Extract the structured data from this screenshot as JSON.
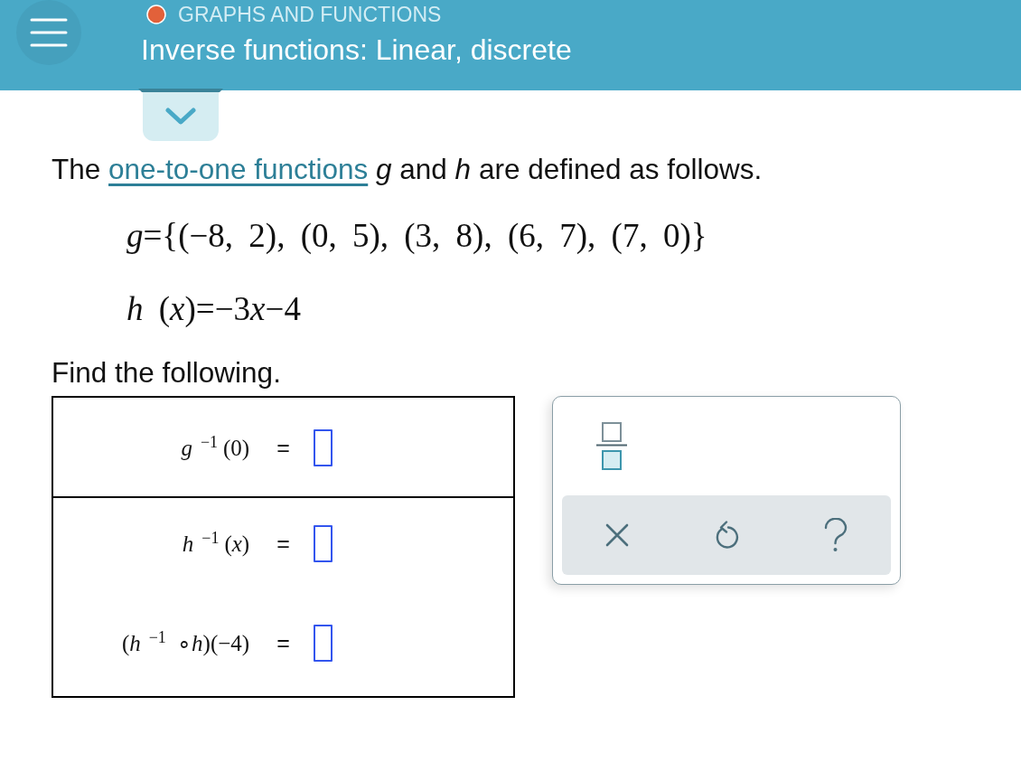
{
  "header": {
    "topic": "GRAPHS AND FUNCTIONS",
    "title": "Inverse functions: Linear, discrete"
  },
  "problem": {
    "statement_start": "The",
    "link": "one-to-one functions",
    "statement_end": "*g* and *h* are defined as follows.",
    "definitions": [
      [
        "*g*={(−8, 2), (0, 5), (3, 8), (6, 7), (7, 0)}"
      ],
      [
        "*h* (*x*)=−3",
        "*x*−4"
      ]
    ],
    "instruction": "Find the following."
  },
  "answer_table": [
    {
      "items": [
        {
          "expression": "*g*$^{−1}$(0)",
          "relation": "="
        }
      ]
    },
    {
      "items": [
        {
          "expression": "*h*$^{−1}$(*x*)",
          "relation": "="
        },
        {
          "expression": "(*h*$^{−1}$ ∘*h*)(−4)",
          "relation": "="
        }
      ]
    }
  ]
}
